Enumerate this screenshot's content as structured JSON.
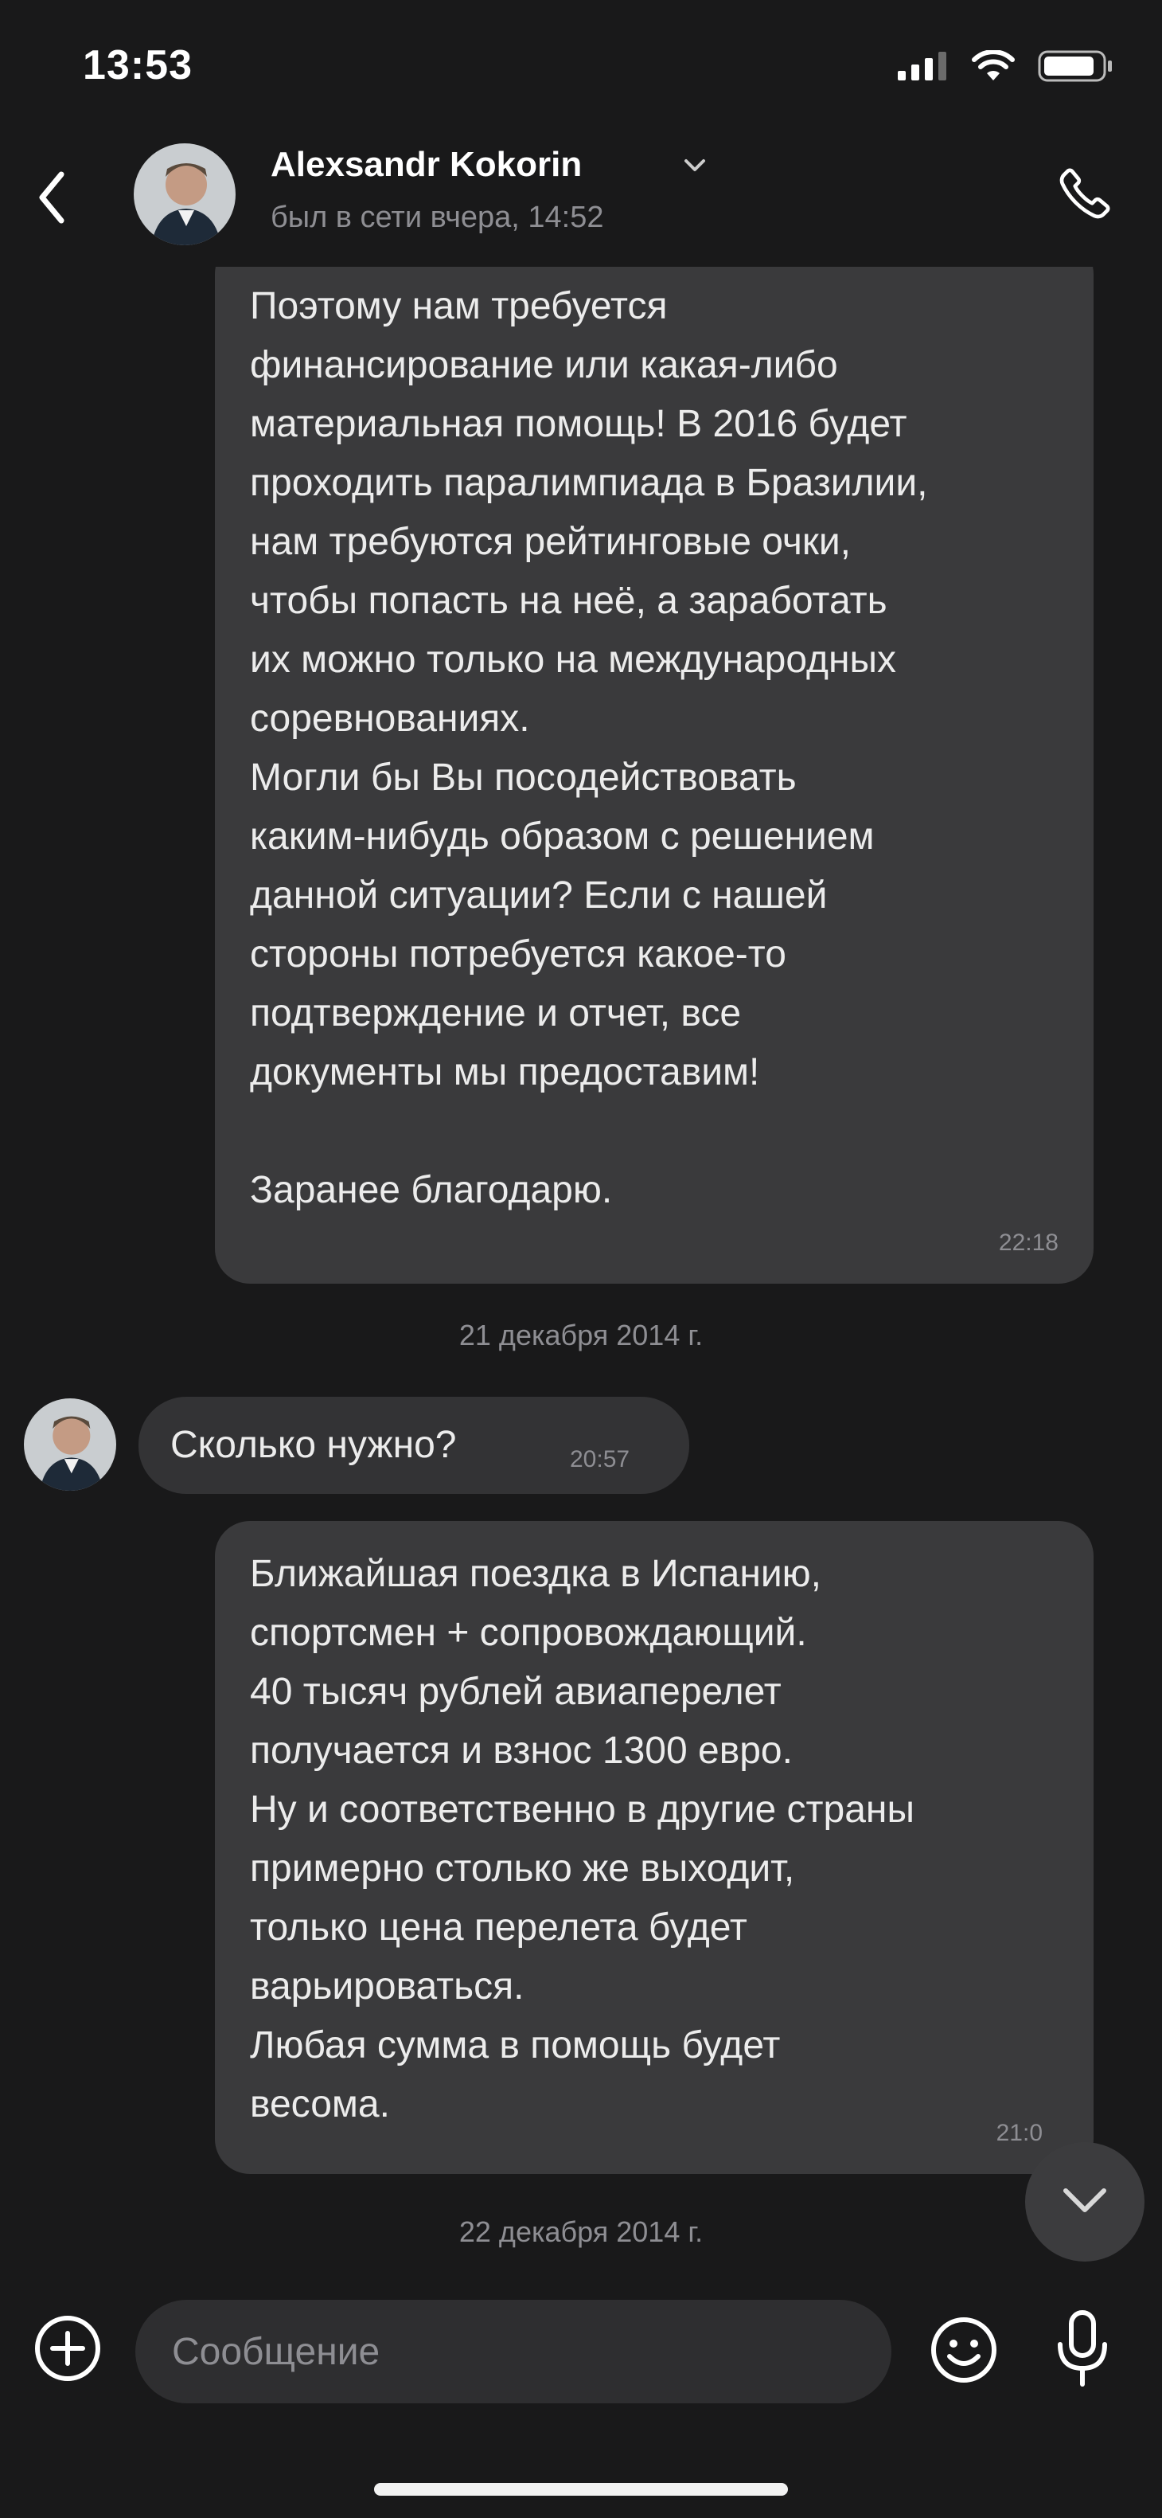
{
  "status_bar": {
    "time": "13:53"
  },
  "header": {
    "contact_name": "Alexsandr Kokorin",
    "contact_status": "был в сети вчера, 14:52"
  },
  "messages": [
    {
      "direction": "outgoing",
      "text": "Поэтому нам требуется\nфинансирование или какая-либо\nматериальная помощь! В 2016 будет\nпроходить паралимпиада в Бразилии,\nнам требуются рейтинговые очки,\nчтобы попасть на неё, а заработать\nих можно только на международных\nсоревнованиях.\nМогли бы Вы посодействовать\nкаким-нибудь образом с решением\nданной ситуации? Если с нашей\nстороны потребуется какое-то\nподтверждение и отчет, все\nдокументы мы предоставим!\n\nЗаранее благодарю.",
      "time": "22:18"
    },
    {
      "type": "date_separator",
      "text": "21 декабря 2014 г."
    },
    {
      "direction": "incoming",
      "text": "Сколько нужно?",
      "time": "20:57"
    },
    {
      "direction": "outgoing",
      "text": "Ближайшая поездка в Испанию,\nспортсмен + сопровождающий.\n40 тысяч рублей авиаперелет\nполучается и взнос 1300 евро.\nНу и соответственно в другие страны\nпримерно столько же выходит,\nтолько цена перелета будет\nварьироваться.\nЛюбая сумма в помощь будет\nвесома.",
      "time": "21:0"
    },
    {
      "type": "date_separator",
      "text": "22 декабря 2014 г."
    }
  ],
  "composer": {
    "placeholder": "Сообщение"
  },
  "icons": {
    "back": "chevron-left-icon",
    "name_dropdown": "chevron-down-icon",
    "call": "phone-icon",
    "scroll_down": "chevron-down-icon",
    "attach": "plus-circle-icon",
    "emoji": "smile-icon",
    "mic": "microphone-icon"
  },
  "colors": {
    "background": "#19191a",
    "bubble": "#3a3a3c",
    "secondary_text": "#8e8e93"
  }
}
